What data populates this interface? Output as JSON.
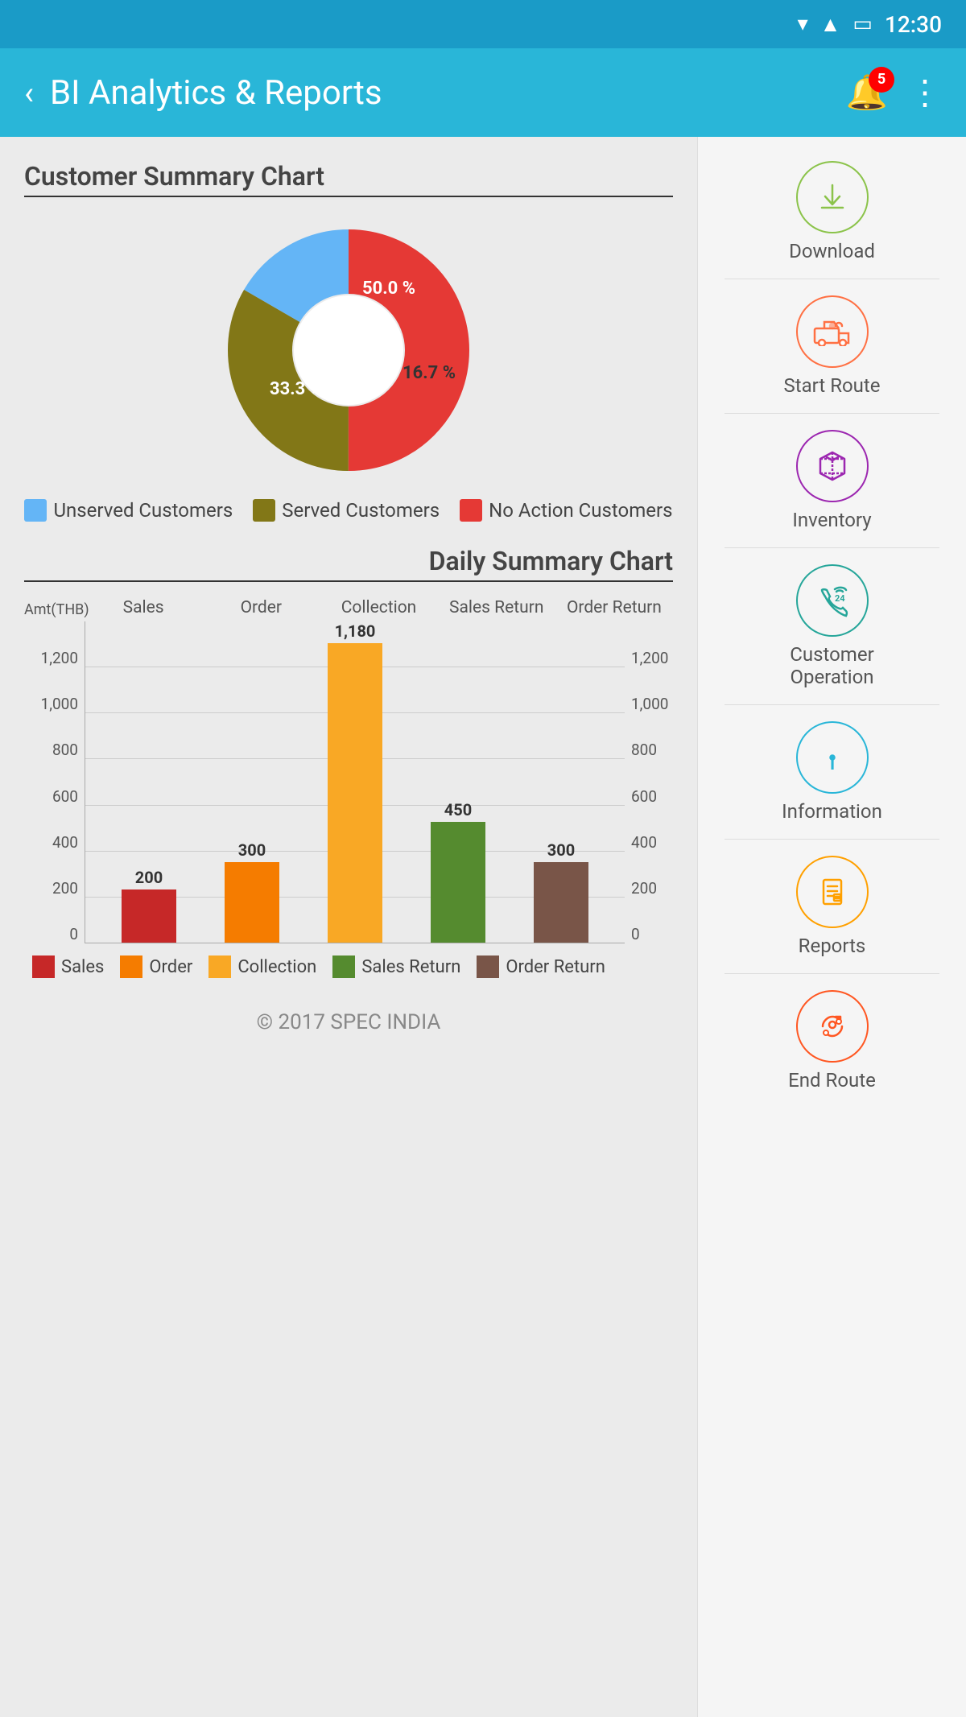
{
  "statusBar": {
    "time": "12:30",
    "batteryIcon": "🔋",
    "signalIcon": "📶",
    "wifiIcon": "▼"
  },
  "appBar": {
    "title": "BI Analytics & Reports",
    "backLabel": "‹",
    "notificationCount": "5",
    "moreIcon": "⋮"
  },
  "customerChart": {
    "title": "Customer Summary Chart",
    "segments": [
      {
        "label": "No Action Customers",
        "percent": 50.0,
        "color": "#e53935",
        "displayPct": "50.0 %"
      },
      {
        "label": "Served Customers",
        "percent": 33.3,
        "color": "#827717",
        "displayPct": "33.3 %"
      },
      {
        "label": "Unserved Customers",
        "percent": 16.7,
        "color": "#64b5f6",
        "displayPct": "16.7 %"
      }
    ],
    "legend": [
      {
        "label": "Unserved Customers",
        "color": "#64b5f6"
      },
      {
        "label": "Served Customers",
        "color": "#827717"
      },
      {
        "label": "No Action Customers",
        "color": "#e53935"
      }
    ]
  },
  "dailyChart": {
    "title": "Daily Summary Chart",
    "yAxisLabel": "Amt(THB)",
    "categories": [
      "Sales",
      "Order",
      "Collection",
      "Sales Return",
      "Order Return"
    ],
    "yLabels": [
      "0",
      "200",
      "400",
      "600",
      "800",
      "1,000",
      "1,200"
    ],
    "bars": [
      {
        "label": "Sales",
        "value": 200,
        "color": "#c62828"
      },
      {
        "label": "Order",
        "value": 300,
        "color": "#f57c00"
      },
      {
        "label": "Collection",
        "value": 1180,
        "color": "#f9a825"
      },
      {
        "label": "Sales Return",
        "value": 450,
        "color": "#558b2f"
      },
      {
        "label": "Order Return",
        "value": 300,
        "color": "#795548"
      }
    ],
    "maxValue": 1200,
    "legend": [
      {
        "label": "Sales",
        "color": "#c62828"
      },
      {
        "label": "Order",
        "color": "#f57c00"
      },
      {
        "label": "Collection",
        "color": "#f9a825"
      },
      {
        "label": "Sales Return",
        "color": "#558b2f"
      },
      {
        "label": "Order Return",
        "color": "#795548"
      }
    ]
  },
  "footer": {
    "text": "© 2017 SPEC INDIA"
  },
  "sidebar": {
    "items": [
      {
        "id": "download",
        "label": "Download",
        "iconClass": "icon-download",
        "icon": "⬇"
      },
      {
        "id": "start-route",
        "label": "Start Route",
        "iconClass": "icon-route",
        "icon": "🚚"
      },
      {
        "id": "inventory",
        "label": "Inventory",
        "iconClass": "icon-inventory",
        "icon": "📦"
      },
      {
        "id": "customer-operation",
        "label": "Customer\nOperation",
        "iconClass": "icon-customer",
        "icon": "📞"
      },
      {
        "id": "information",
        "label": "Information",
        "iconClass": "icon-info",
        "icon": "ℹ"
      },
      {
        "id": "reports",
        "label": "Reports",
        "iconClass": "icon-reports",
        "icon": "📋"
      },
      {
        "id": "end-route",
        "label": "End Route",
        "iconClass": "icon-end-route",
        "icon": "🔄"
      }
    ]
  }
}
